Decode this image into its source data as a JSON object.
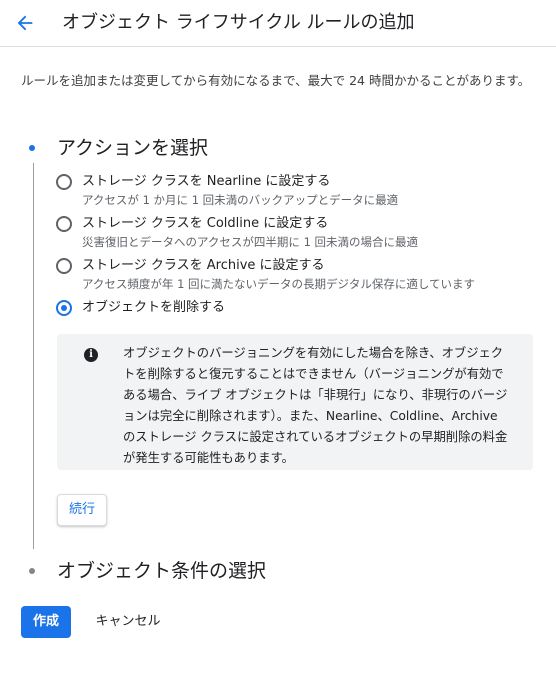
{
  "header": {
    "title": "オブジェクト ライフサイクル ルールの追加",
    "back_icon": "arrow-back-icon"
  },
  "notice": "ルールを追加または変更してから有効になるまで、最大で 24 時間かかることがあります。",
  "steps": [
    {
      "title": "アクションを選択"
    },
    {
      "title": "オブジェクト条件の選択"
    }
  ],
  "options": [
    {
      "label": "ストレージ クラスを Nearline に設定する",
      "desc": "アクセスが 1 か月に 1 回未満のバックアップとデータに最適",
      "checked": false
    },
    {
      "label": "ストレージ クラスを Coldline に設定する",
      "desc": "災害復旧とデータへのアクセスが四半期に 1 回未満の場合に最適",
      "checked": false
    },
    {
      "label": "ストレージ クラスを Archive に設定する",
      "desc": "アクセス頻度が年 1 回に満たないデータの長期デジタル保存に適しています",
      "checked": false
    },
    {
      "label": "オブジェクトを削除する",
      "desc": "",
      "checked": true
    }
  ],
  "info": {
    "icon": "info-icon",
    "text": "オブジェクトのバージョニングを有効にした場合を除き、オブジェクトを削除すると復元することはできません（バージョニングが有効である場合、ライブ オブジェクトは「非現行」になり、非現行のバージョンは完全に削除されます）。また、Nearline、Coldline、Archive のストレージ クラスに設定されているオブジェクトの早期削除の料金が発生する可能性もあります。"
  },
  "buttons": {
    "continue": "続行",
    "create": "作成",
    "cancel": "キャンセル"
  },
  "colors": {
    "accent": "#1a73e8",
    "info_bg": "#f1f3f4"
  }
}
